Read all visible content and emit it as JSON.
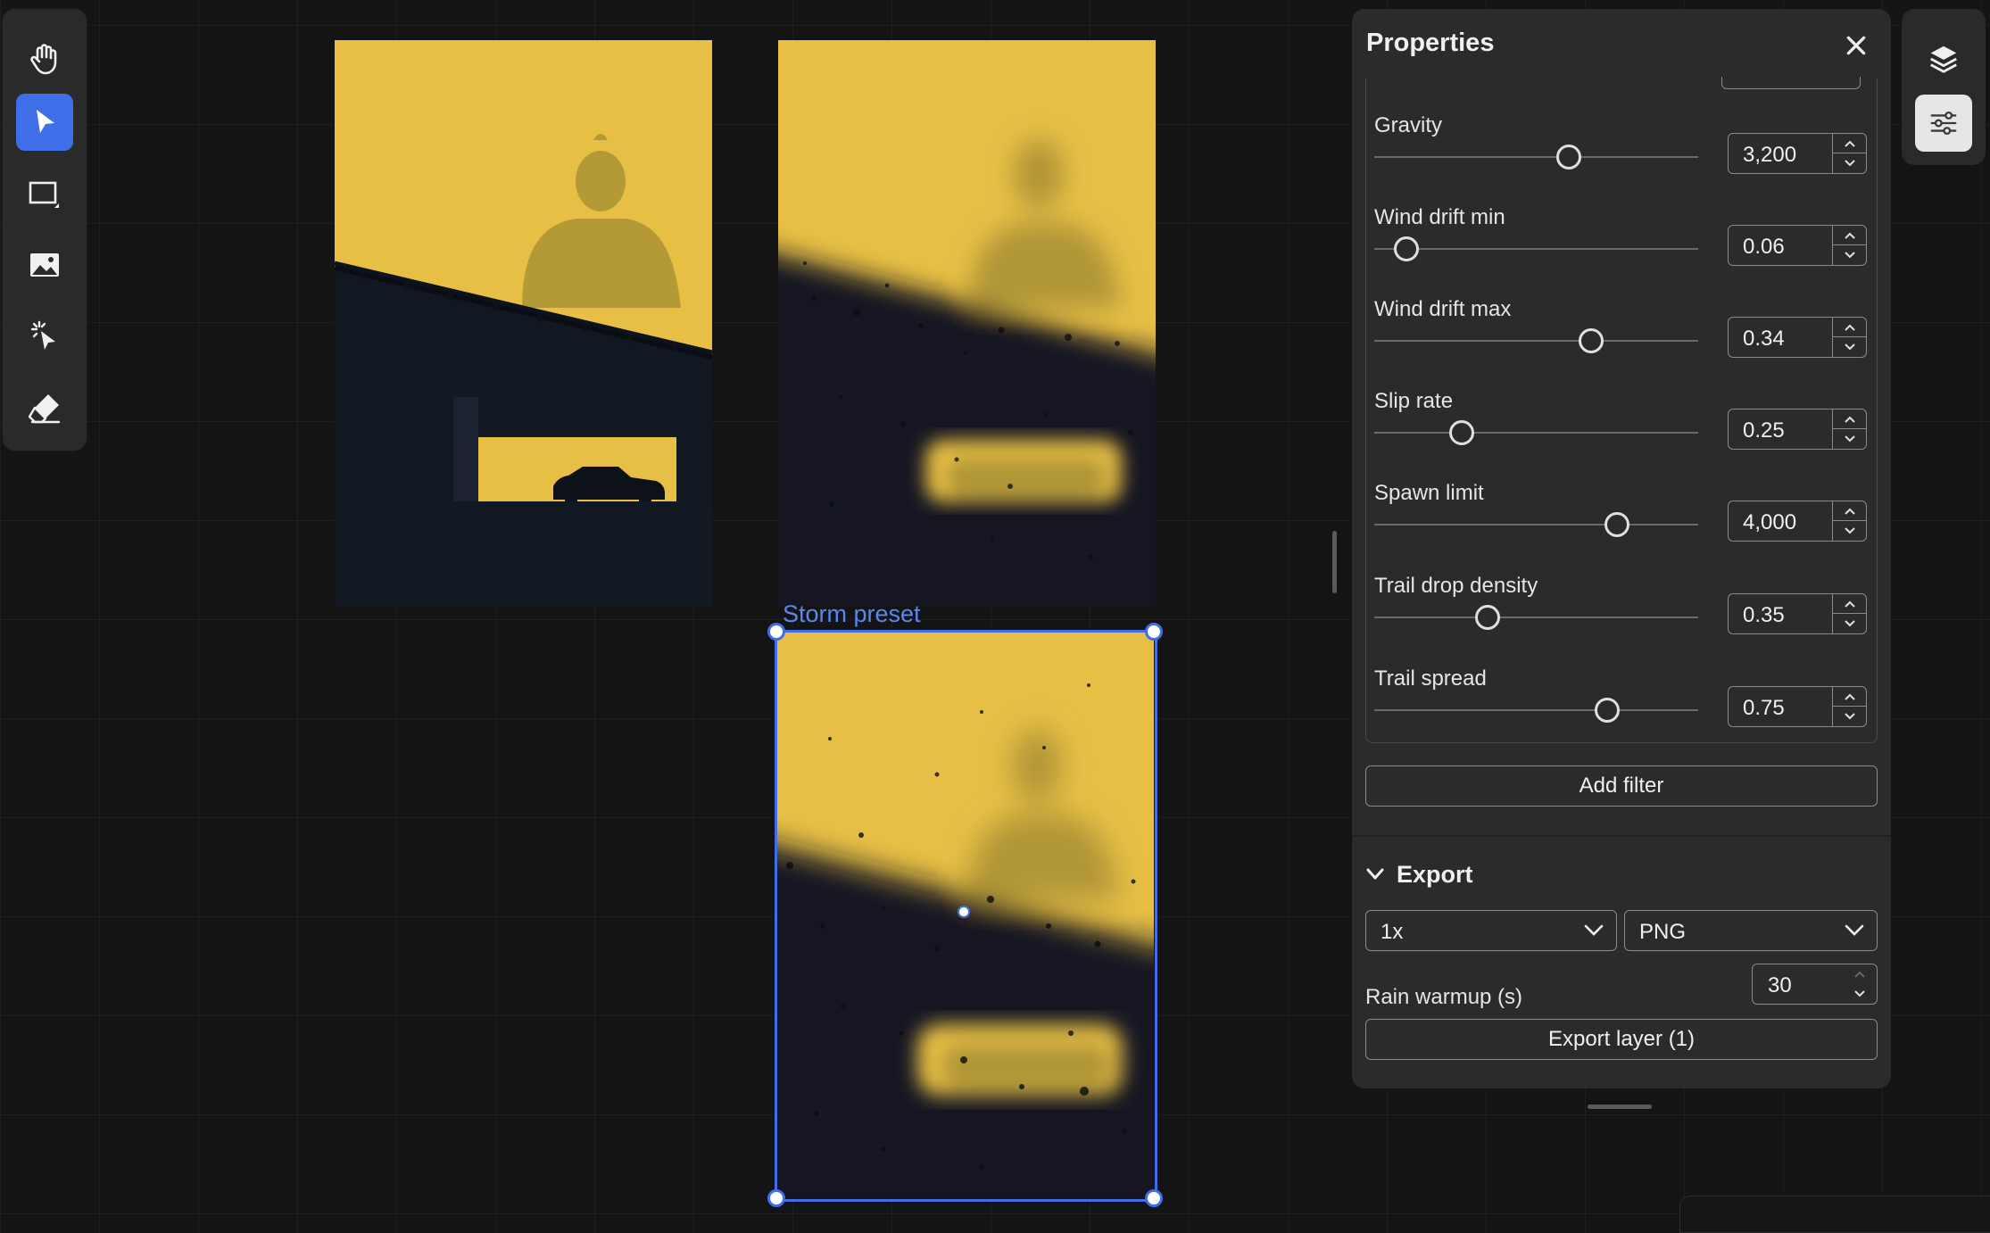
{
  "panel": {
    "title": "Properties",
    "properties": [
      {
        "label": "Gravity",
        "value": "3,200",
        "level": 0.6
      },
      {
        "label": "Wind drift min",
        "value": "0.06",
        "level": 0.1
      },
      {
        "label": "Wind drift max",
        "value": "0.34",
        "level": 0.67
      },
      {
        "label": "Slip rate",
        "value": "0.25",
        "level": 0.27
      },
      {
        "label": "Spawn limit",
        "value": "4,000",
        "level": 0.75
      },
      {
        "label": "Trail drop density",
        "value": "0.35",
        "level": 0.35
      },
      {
        "label": "Trail spread",
        "value": "0.75",
        "level": 0.72
      }
    ],
    "add_filter_label": "Add filter",
    "export": {
      "section_label": "Export",
      "scale": "1x",
      "format": "PNG",
      "rain_warmup_label": "Rain warmup (s)",
      "rain_warmup_value": "30",
      "export_button_label": "Export layer (1)"
    }
  },
  "canvas": {
    "selected_frame_label": "Storm preset"
  },
  "toolbar": {
    "tools": [
      "hand-tool",
      "select-tool",
      "rectangle-tool",
      "image-tool",
      "magic-select-tool",
      "eraser-tool"
    ],
    "active_tool": "select-tool"
  },
  "colors": {
    "accent": "#3f6ee8",
    "image_yellow": "#e7bf45",
    "image_dark": "#141a24"
  }
}
